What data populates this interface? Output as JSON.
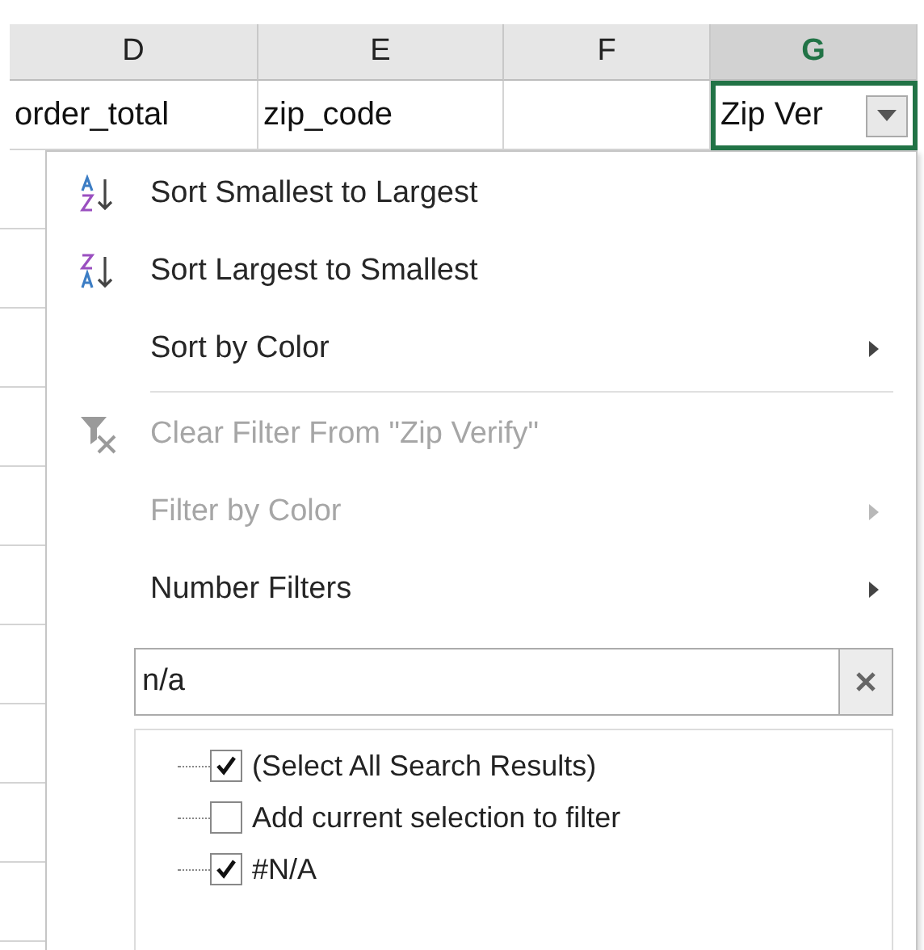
{
  "columns": [
    {
      "label": "D",
      "selected": false
    },
    {
      "label": "E",
      "selected": false
    },
    {
      "label": "F",
      "selected": false
    },
    {
      "label": "G",
      "selected": true
    }
  ],
  "header_row": [
    {
      "text": "order_total",
      "filter": false,
      "selected": false
    },
    {
      "text": "zip_code",
      "filter": false,
      "selected": false
    },
    {
      "filter": false,
      "selected": false
    },
    {
      "text": "Zip Ver",
      "filter": true,
      "selected": true
    }
  ],
  "menu": {
    "items": [
      {
        "kind": "sort_asc",
        "label": "Sort Smallest to Largest",
        "disabled": false,
        "submenu": false
      },
      {
        "kind": "sort_desc",
        "label": "Sort Largest to Smallest",
        "disabled": false,
        "submenu": false
      },
      {
        "kind": "plain",
        "label": "Sort by Color",
        "disabled": false,
        "submenu": true
      },
      {
        "kind": "separator"
      },
      {
        "kind": "clear_filter",
        "label": "Clear Filter From \"Zip Verify\"",
        "disabled": true,
        "submenu": false
      },
      {
        "kind": "plain",
        "label": "Filter by Color",
        "disabled": true,
        "submenu": true
      },
      {
        "kind": "plain",
        "label": "Number Filters",
        "disabled": false,
        "submenu": true
      }
    ],
    "search": {
      "value": "n/a"
    },
    "values": [
      {
        "label": "(Select All Search Results)",
        "checked": true
      },
      {
        "label": "Add current selection to filter",
        "checked": false
      },
      {
        "label": "#N/A",
        "checked": true
      }
    ]
  }
}
